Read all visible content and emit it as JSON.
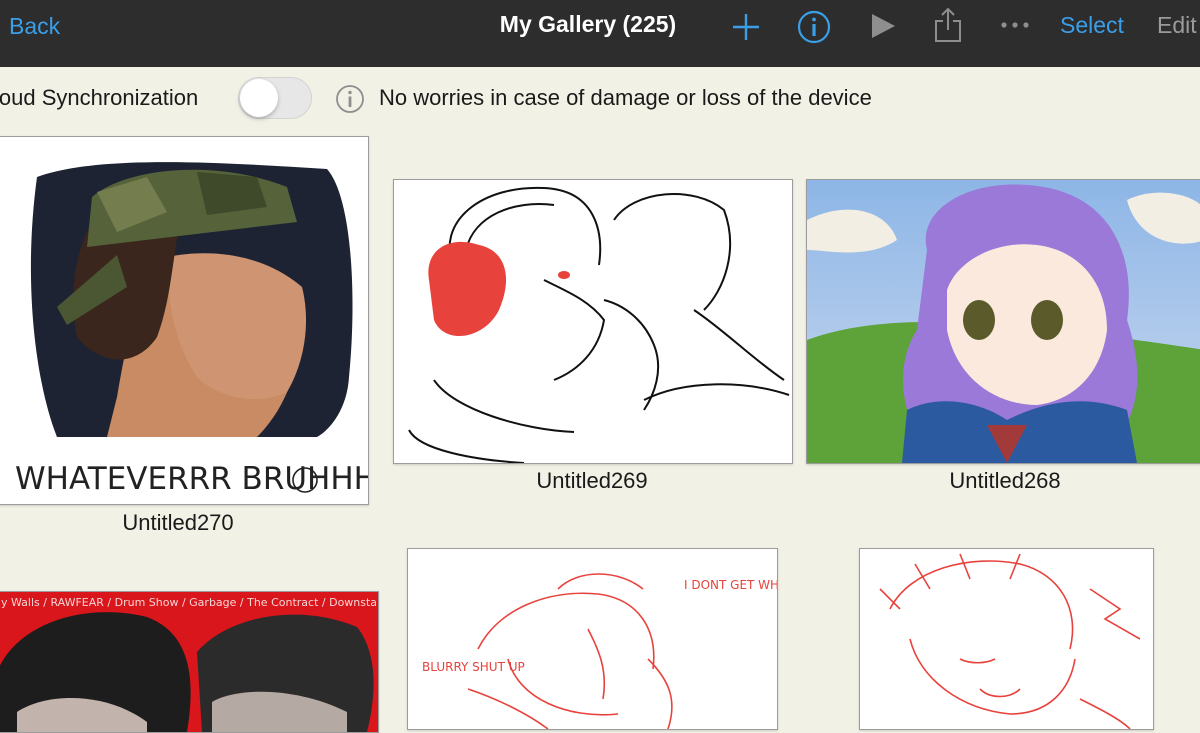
{
  "topbar": {
    "back_label": "Back",
    "title": "My Gallery (225)",
    "select_label": "Select",
    "edit_label": "Edit",
    "icons": [
      "plus-icon",
      "info-icon",
      "play-icon",
      "share-icon",
      "more-icon"
    ]
  },
  "sync": {
    "label": "loud Synchronization",
    "enabled": false,
    "note": "No worries in case of damage or loss of the device"
  },
  "gallery": {
    "items": [
      {
        "name": "Untitled270",
        "art_text": "WHATEVERRR BRUHHHH"
      },
      {
        "name": "Untitled269"
      },
      {
        "name": "Untitled268"
      }
    ],
    "partial_items": [
      {
        "art_text": "y Walls / RAWFEAR / Drum Show / Garbage / The Contract / Downstairs / obot Voices / Co  ottonwood / ... / Dormant / Tally  WFEA ... / Cent / City W / Y / ormar / egac / The"
      },
      {
        "art_text_1": "I DONT GET WHY YOU HAVE TO BE HERE",
        "art_text_2": "BLURRY SHUT UP"
      },
      {}
    ]
  },
  "colors": {
    "accent": "#3b9fe8",
    "topbar_bg": "#2d2d2d",
    "page_bg": "#f2f1e6",
    "sketch_red": "#e8423c"
  }
}
